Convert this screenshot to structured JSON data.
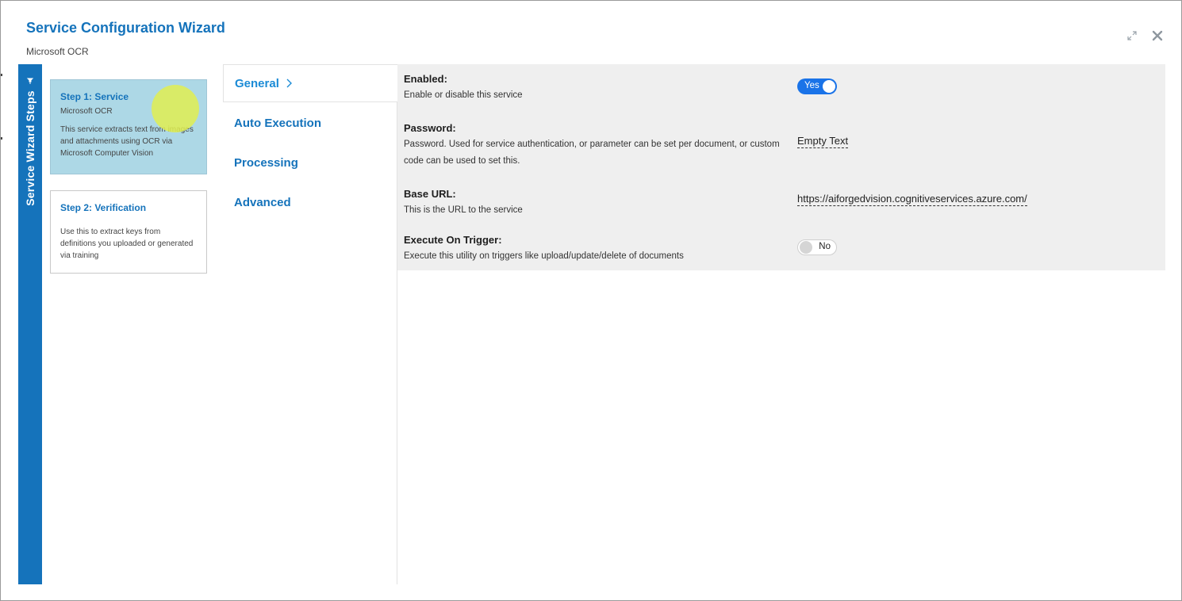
{
  "header": {
    "title": "Service Configuration Wizard",
    "subtitle": "Microsoft OCR"
  },
  "steps_rail": {
    "label": "Service Wizard Steps"
  },
  "steps": [
    {
      "title": "Step 1: Service",
      "subtitle": "Microsoft OCR",
      "description": "This service extracts text from images and attachments using OCR via Microsoft Computer Vision",
      "active": true
    },
    {
      "title": "Step 2: Verification",
      "description": "Use this to extract keys from definitions you uploaded or generated via training",
      "active": false
    }
  ],
  "sections": [
    {
      "label": "General",
      "active": true
    },
    {
      "label": "Auto Execution",
      "active": false
    },
    {
      "label": "Processing",
      "active": false
    },
    {
      "label": "Advanced",
      "active": false
    }
  ],
  "settings": {
    "enabled": {
      "label": "Enabled:",
      "description": "Enable or disable this service",
      "value": "Yes"
    },
    "password": {
      "label": "Password:",
      "description": "Password. Used for service authentication, or parameter can be set per document, or custom code can be used to set this.",
      "value": "Empty Text"
    },
    "base_url": {
      "label": "Base URL:",
      "description": "This is the URL to the service",
      "value": "https://aiforgedvision.cognitiveservices.azure.com/"
    },
    "execute_on_trigger": {
      "label": "Execute On Trigger:",
      "description": "Execute this utility on triggers like upload/update/delete of documents",
      "value": "No"
    }
  },
  "colors": {
    "accent": "#1573bb",
    "active_step_bg": "#add8e6",
    "toggle_on": "#1a73e8",
    "panel_bg": "#efefef"
  },
  "icons": {
    "expand": "expand-icon",
    "close": "close-icon",
    "pin": "pin-icon",
    "chevron": "chevron-right-icon"
  }
}
